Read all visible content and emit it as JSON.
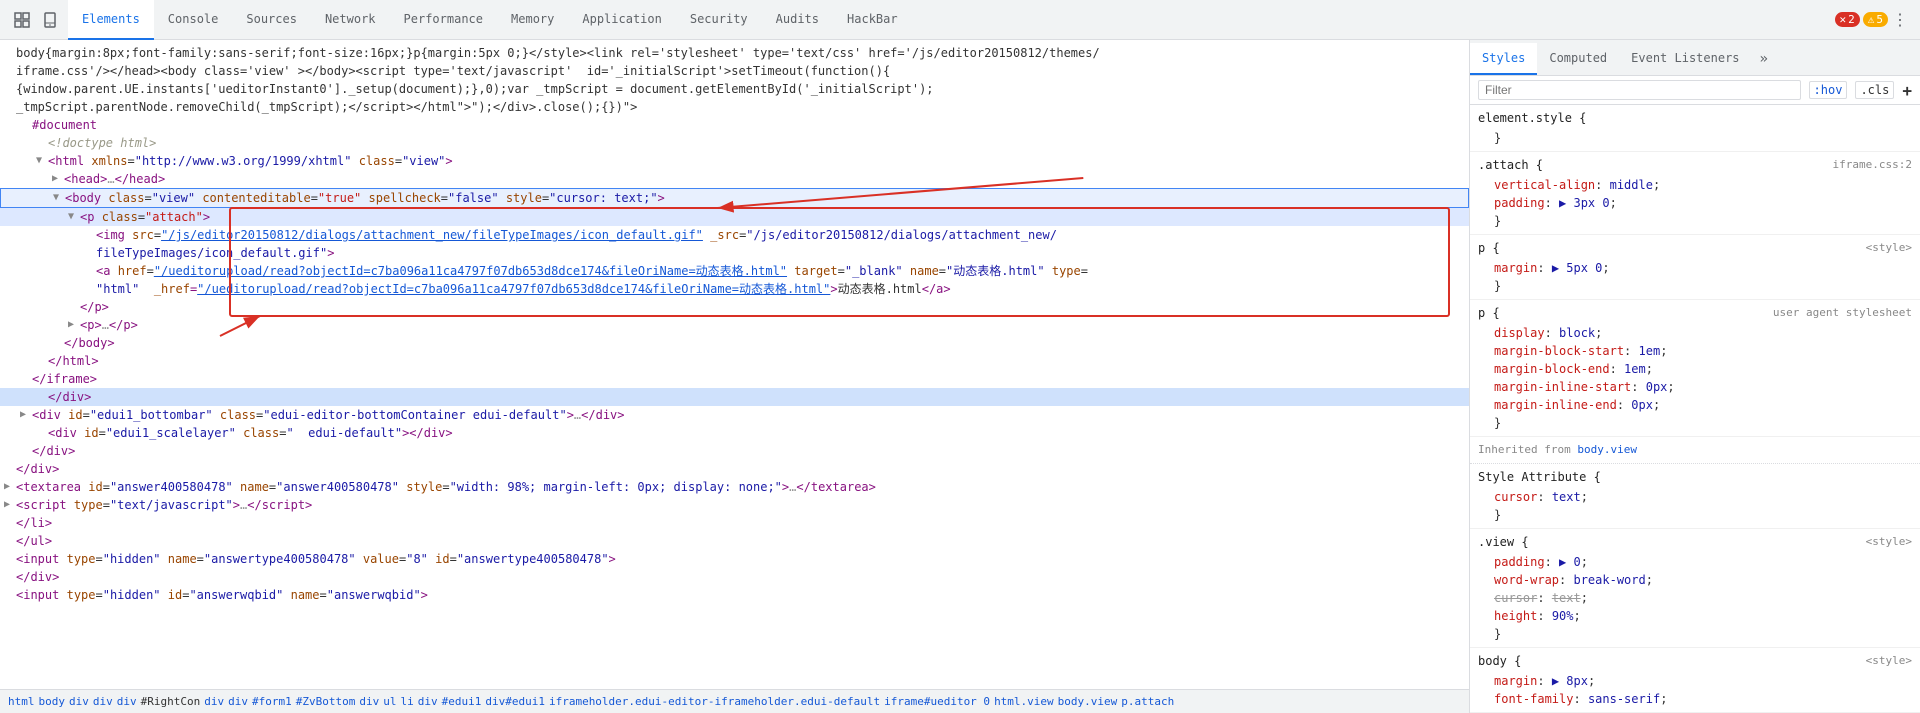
{
  "tabs": {
    "items": [
      {
        "label": "Elements",
        "active": true
      },
      {
        "label": "Console",
        "active": false
      },
      {
        "label": "Sources",
        "active": false
      },
      {
        "label": "Network",
        "active": false
      },
      {
        "label": "Performance",
        "active": false
      },
      {
        "label": "Memory",
        "active": false
      },
      {
        "label": "Application",
        "active": false
      },
      {
        "label": "Security",
        "active": false
      },
      {
        "label": "Audits",
        "active": false
      },
      {
        "label": "HackBar",
        "active": false
      }
    ],
    "error_count": "2",
    "warning_count": "5"
  },
  "styles_panel": {
    "tabs": [
      {
        "label": "Styles",
        "active": true
      },
      {
        "label": "Computed",
        "active": false
      },
      {
        "label": "Event Listeners",
        "active": false
      }
    ],
    "filter_placeholder": "Filter",
    "filter_hov": ":hov",
    "filter_cls": ".cls",
    "rules": [
      {
        "selector": "element.style {",
        "source": "",
        "props": []
      },
      {
        "selector": ".attach {",
        "source": "iframe.css:2",
        "props": [
          {
            "name": "vertical-align",
            "value": "middle",
            "strikethrough": false
          },
          {
            "name": "padding",
            "value": "▶ 3px 0",
            "strikethrough": false
          }
        ]
      },
      {
        "selector": "p {",
        "source": "<style>",
        "props": [
          {
            "name": "margin",
            "value": "▶ 5px 0",
            "strikethrough": false
          }
        ]
      },
      {
        "selector": "p {",
        "source": "user agent stylesheet",
        "props": [
          {
            "name": "display",
            "value": "block",
            "strikethrough": false
          },
          {
            "name": "margin-block-start",
            "value": "1em",
            "strikethrough": false
          },
          {
            "name": "margin-block-end",
            "value": "1em",
            "strikethrough": false
          },
          {
            "name": "margin-inline-start",
            "value": "0px",
            "strikethrough": false
          },
          {
            "name": "margin-inline-end",
            "value": "0px",
            "strikethrough": false
          }
        ]
      },
      {
        "inherited_from": "body.view",
        "label": "Inherited from"
      },
      {
        "selector": "Style Attribute {",
        "source": "",
        "props": [
          {
            "name": "cursor",
            "value": "text",
            "strikethrough": false
          }
        ]
      },
      {
        "selector": ".view {",
        "source": "<style>",
        "props": [
          {
            "name": "padding",
            "value": "▶ 0",
            "strikethrough": false
          },
          {
            "name": "word-wrap",
            "value": "break-word",
            "strikethrough": false
          },
          {
            "name": "cursor",
            "value": "text",
            "strikethrough": true
          },
          {
            "name": "height",
            "value": "90%",
            "strikethrough": false
          }
        ]
      },
      {
        "selector": "body {",
        "source": "<style>",
        "props": [
          {
            "name": "margin",
            "value": "▶ 8px",
            "strikethrough": false
          },
          {
            "name": "font-family",
            "value": "sans-serif",
            "strikethrough": false
          }
        ]
      }
    ]
  },
  "breadcrumb": {
    "items": [
      {
        "label": "html",
        "id": null
      },
      {
        "label": "body",
        "id": null
      },
      {
        "label": "div",
        "id": null
      },
      {
        "label": "div",
        "id": null
      },
      {
        "label": "div",
        "id": "#RightCon"
      },
      {
        "label": "div",
        "id": null
      },
      {
        "label": "div",
        "id": null
      },
      {
        "label": "#form1",
        "id": null
      },
      {
        "label": "#ZvBottom",
        "id": null
      },
      {
        "label": "div",
        "id": null
      },
      {
        "label": "ul",
        "id": null
      },
      {
        "label": "li",
        "id": null
      },
      {
        "label": "div",
        "id": null
      },
      {
        "label": "#edui1",
        "id": null
      },
      {
        "label": "div#edui1",
        "id": null
      },
      {
        "label": "iframeholder.edui-editor-iframeholder.edui-default",
        "id": null
      },
      {
        "label": "iframe#ueditor 0",
        "id": null
      },
      {
        "label": "html.view",
        "id": null
      },
      {
        "label": "body.view",
        "id": null
      },
      {
        "label": "p.attach",
        "id": null
      }
    ]
  },
  "dom_content": {
    "lines": [
      {
        "indent": 0,
        "arrow": "none",
        "html": "<span class='text-node'>body{margin:8px;font-family:sans-serif;font-size:16px;}p{margin:5px 0;}&lt;/style&gt;&lt;link rel='stylesheet' type='text/css' href='/js/editor20150812/themes/</span>"
      },
      {
        "indent": 0,
        "arrow": "none",
        "html": "<span class='text-node'>iframe.css'/&gt;&lt;/head&gt;&lt;body class='view' &gt;&lt;/body&gt;&lt;script type='text/javascript'  id='_initialScript'&gt;setTimeout(function(){</span>"
      },
      {
        "indent": 0,
        "arrow": "none",
        "html": "<span class='text-node'>{window.parent.UE.instants['ueditorInstant0']._setup(document);},0);var _tmpScript = document.getElementById('_initialScript');</span>"
      },
      {
        "indent": 0,
        "arrow": "none",
        "html": "<span class='text-node'>_tmpScript.parentNode.removeChild(_tmpScript);&lt;/script&gt;&lt;/html\"&gt;&quot;);&lt;/div&gt;.close();{})\"&gt;</span>"
      },
      {
        "indent": 1,
        "arrow": "none",
        "html": "<span class='tag'>#document</span>"
      },
      {
        "indent": 2,
        "arrow": "none",
        "html": "<span class='comment'>&lt;!doctype html&gt;</span>"
      },
      {
        "indent": 2,
        "arrow": "open",
        "html": "<span class='tag'>&lt;html</span> <span class='attr-name'>xmlns</span><span>=</span><span class='attr-value'>\"http://www.w3.org/1999/xhtml\"</span> <span class='attr-name'>class</span><span>=</span><span class='attr-value'>\"view\"</span><span class='tag'>&gt;</span>"
      },
      {
        "indent": 3,
        "arrow": "closed",
        "html": "<span class='tag'>&lt;head&gt;</span><span class='ellipsis-dots'>…</span><span class='tag'>&lt;/head&gt;</span>"
      },
      {
        "indent": 3,
        "arrow": "open",
        "html": "<span class='tag'>&lt;body</span> <span class='attr-name'>class</span><span>=</span><span class='attr-value'>\"view\"</span> <span class='attr-name'>contenteditable</span><span>=</span><span class='attr-value-red'>\"true\"</span> <span class='attr-name'>spellcheck</span><span>=</span><span class='attr-value'>\"false\"</span> <span class='attr-name'>style</span><span>=</span><span class='attr-value'>\"cursor: text;\"</span><span class='tag'>&gt;</span>",
        "highlighted": true
      },
      {
        "indent": 4,
        "arrow": "open",
        "html": "<span class='tag'>&lt;p</span> <span class='attr-name'>class</span><span>=</span><span class='attr-value-red'>\"attach\"</span><span class='tag'>&gt;</span>",
        "selected": true
      },
      {
        "indent": 5,
        "arrow": "none",
        "html": "<span class='tag'>&lt;img</span> <span class='attr-name'>src</span><span>=</span><span class='attr-value link-blue'>\"/js/editor20150812/dialogs/attachment_new/fileTypeImages/icon_default.gif\"</span> <span class='attr-name'>_src</span><span>=</span><span class='attr-value'>\"/js/editor20150812/dialogs/attachment_new/</span>"
      },
      {
        "indent": 5,
        "arrow": "none",
        "html": "<span class='attr-value'>fileTypeImages/icon_default.gif\"</span><span class='tag'>&gt;</span>"
      },
      {
        "indent": 5,
        "arrow": "none",
        "html": "<span class='tag'>&lt;a</span> <span class='attr-name'>href</span><span>=</span><span class='attr-value link-blue'>\"/ueditorupload/read?objectId=c7ba096a11ca4797f07db653d8dce174&amp;fileOriName=动态表格.html\"</span> <span class='attr-name'>target</span><span>=</span><span class='attr-value'>\"_blank\"</span> <span class='attr-name'>name</span><span>=</span><span class='attr-value'>\"动态表格.html\"</span> <span class='attr-name'>type</span><span>=</span>"
      },
      {
        "indent": 5,
        "arrow": "none",
        "html": "<span class='attr-value'>\"html\"</span>  <span class='attr-name'>_href</span><span class='tag'>=</span><span class='attr-value link-blue'>\"/ueditorupload/read?objectId=c7ba096a11ca4797f07db653d8dce174&amp;fileOriName=动态表格.html\"</span><span class='tag'>&gt;</span><span class='text-node'>动态表格.html</span><span class='tag'>&lt;/a&gt;</span>"
      },
      {
        "indent": 4,
        "arrow": "none",
        "html": "<span class='tag'>&lt;/p&gt;</span>"
      },
      {
        "indent": 4,
        "arrow": "closed",
        "html": "<span class='tag'>&lt;p&gt;</span><span class='ellipsis-dots'>…</span><span class='tag'>&lt;/p&gt;</span>"
      },
      {
        "indent": 3,
        "arrow": "none",
        "html": "<span class='tag'>&lt;/body&gt;</span>"
      },
      {
        "indent": 2,
        "arrow": "none",
        "html": "<span class='tag'>&lt;/html&gt;</span>"
      },
      {
        "indent": 1,
        "arrow": "none",
        "html": "<span class='tag'>&lt;/iframe&gt;</span>"
      },
      {
        "indent": 2,
        "arrow": "none",
        "html": "<span class='tag'>&lt;/div&gt;</span>",
        "line_selected_blue": true
      },
      {
        "indent": 1,
        "arrow": "closed",
        "html": "<span class='tag'>&lt;div</span> <span class='attr-name'>id</span><span>=</span><span class='hash-id'>\"edui1_bottombar\"</span> <span class='attr-name'>class</span><span>=</span><span class='attr-value'>\"edui-editor-bottomContainer edui-default\"</span><span class='tag'>&gt;</span><span class='ellipsis-dots'>…</span><span class='tag'>&lt;/div&gt;</span>"
      },
      {
        "indent": 2,
        "arrow": "none",
        "html": "<span class='tag'>&lt;div</span> <span class='attr-name'>id</span><span>=</span><span class='hash-id'>\"edui1_scalelayer\"</span> <span class='attr-name'>class</span><span>=</span><span class='attr-value'>\"  edui-default\"</span><span class='tag'>&gt;&lt;/div&gt;</span>"
      },
      {
        "indent": 1,
        "arrow": "none",
        "html": "<span class='tag'>&lt;/div&gt;</span>"
      },
      {
        "indent": 0,
        "arrow": "none",
        "html": "<span class='tag'>&lt;/div&gt;</span>"
      },
      {
        "indent": 0,
        "arrow": "closed",
        "html": "<span class='tag'>&lt;textarea</span> <span class='attr-name'>id</span><span>=</span><span class='hash-id'>\"answer400580478\"</span> <span class='attr-name'>name</span><span>=</span><span class='attr-value'>\"answer400580478\"</span> <span class='attr-name'>style</span><span>=</span><span class='attr-value'>\"width: 98%; margin-left: 0px; display: none;\"</span><span class='tag'>&gt;</span><span class='ellipsis-dots'>…</span><span class='tag'>&lt;/textarea&gt;</span>"
      },
      {
        "indent": 0,
        "arrow": "closed",
        "html": "<span class='tag'>&lt;script</span> <span class='attr-name'>type</span><span>=</span><span class='attr-value'>\"text/javascript\"</span><span class='tag'>&gt;</span><span class='ellipsis-dots'>…</span><span class='tag'>&lt;/script&gt;</span>"
      },
      {
        "indent": 0,
        "arrow": "none",
        "html": "<span class='tag'>&lt;/li&gt;</span>"
      },
      {
        "indent": 0,
        "arrow": "none",
        "html": "<span class='tag'>&lt;/ul&gt;</span>"
      },
      {
        "indent": 0,
        "arrow": "none",
        "html": "<span class='tag'>&lt;input</span> <span class='attr-name'>type</span><span>=</span><span class='attr-value'>\"hidden\"</span> <span class='attr-name'>name</span><span>=</span><span class='attr-value'>\"answertype400580478\"</span> <span class='attr-name'>value</span><span>=</span><span class='attr-value'>\"8\"</span> <span class='attr-name'>id</span><span>=</span><span class='hash-id'>\"answertype400580478\"</span><span class='tag'>&gt;</span>"
      },
      {
        "indent": 0,
        "arrow": "none",
        "html": "<span class='tag'>&lt;/div&gt;</span>"
      },
      {
        "indent": 0,
        "arrow": "none",
        "html": "<span class='tag'>&lt;input</span> <span class='attr-name'>type</span><span>=</span><span class='attr-value'>\"hidden\"</span> <span class='attr-name'>id</span><span>=</span><span class='hash-id'>\"answerwqbid\"</span> <span class='attr-name'>name</span><span>=</span><span class='attr-value'>\"answerwqbid\"</span><span class='tag'>&gt;</span>"
      }
    ]
  }
}
